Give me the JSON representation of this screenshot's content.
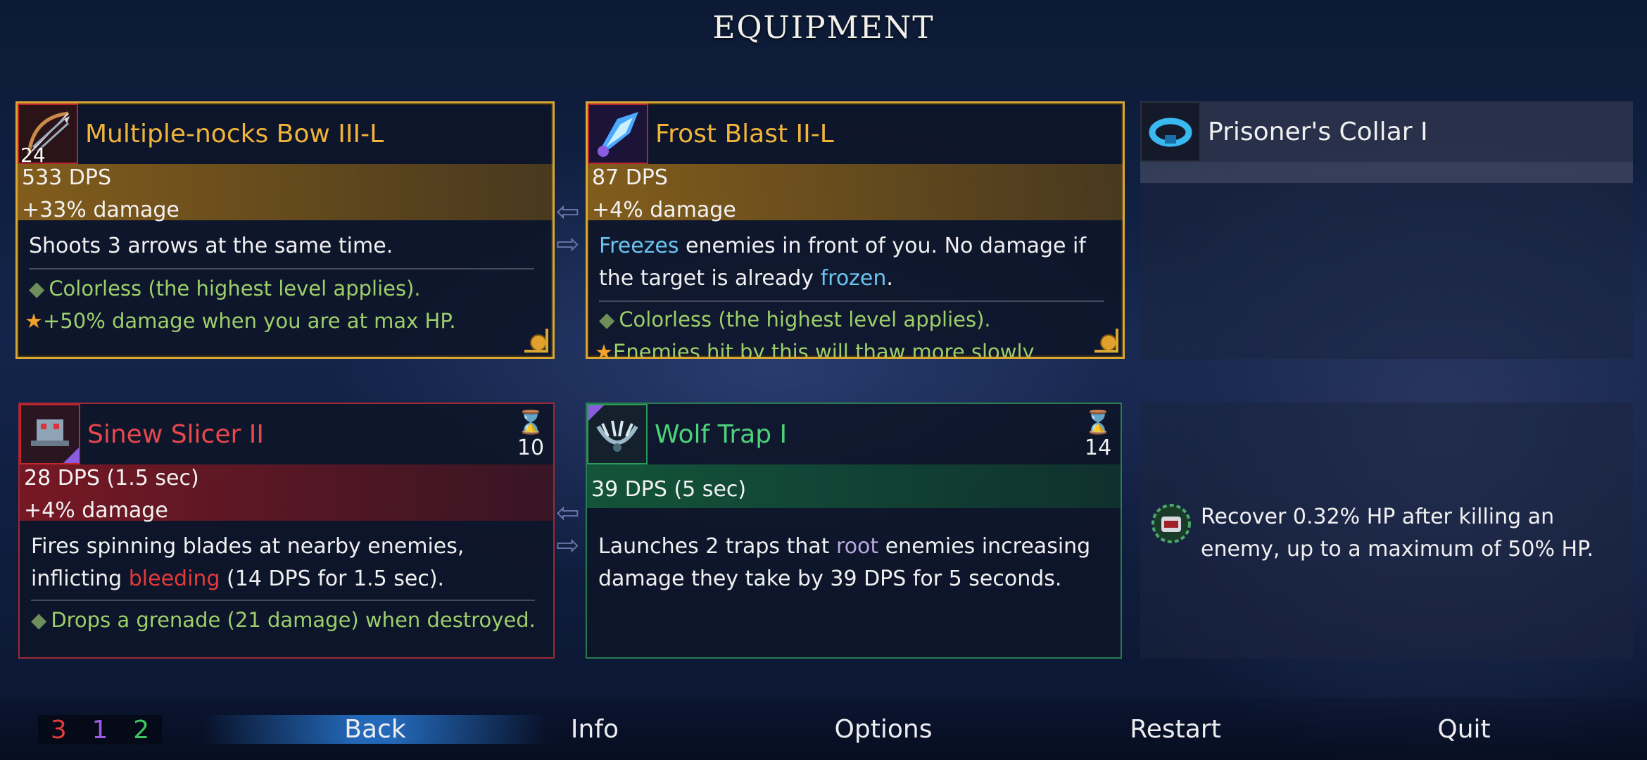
{
  "screen_title": "EQUIPMENT",
  "colors": {
    "gold": "#d9a832",
    "brutality": "#e23c3c",
    "tactics": "#9a5ce0",
    "survival": "#3cc860",
    "freeze": "#6cc4f0"
  },
  "cards": {
    "bow": {
      "name": "Multiple-nocks Bow III-L",
      "icon": "bow-icon",
      "ammo": "24",
      "dps": "533 DPS",
      "damage": "+33% damage",
      "description": "Shoots 3 arrows at the same time.",
      "bullets": [
        "Colorless (the highest level applies).",
        "+50% damage when you are at max HP."
      ]
    },
    "frost": {
      "name": "Frost Blast II-L",
      "icon": "frost-blast-icon",
      "dps": "87 DPS",
      "damage": "+4% damage",
      "desc_kw1": "Freezes",
      "desc_mid": " enemies in front of you. No damage if the target is already ",
      "desc_kw2": "frozen",
      "desc_end": ".",
      "bullets": [
        "Colorless (the highest level applies).",
        "Enemies hit by this will thaw more slowly"
      ]
    },
    "amulet": {
      "name": "Prisoner's Collar I",
      "icon": "collar-icon"
    },
    "slicer": {
      "name": "Sinew Slicer II",
      "icon": "sinew-slicer-icon",
      "cooldown": "10",
      "dps": "28 DPS (1.5 sec)",
      "damage": "+4% damage",
      "desc_start": "Fires spinning blades at nearby enemies, inflicting ",
      "desc_kw": "bleeding",
      "desc_end": " (14 DPS for 1.5 sec).",
      "bullets": [
        "Drops a grenade (21 damage) when destroyed."
      ]
    },
    "trap": {
      "name": "Wolf Trap I",
      "icon": "wolf-trap-icon",
      "cooldown": "14",
      "dps": "39 DPS (5 sec)",
      "desc_start": "Launches 2 traps that ",
      "desc_kw": "root",
      "desc_end": " enemies increasing damage they take by 39 DPS for 5 seconds."
    },
    "mutation": {
      "icon": "mutation-icon",
      "description": "Recover 0.32% HP after killing an enemy, up to a maximum of 50% HP."
    }
  },
  "scroll_counts": {
    "brutality": "3",
    "tactics": "1",
    "survival": "2"
  },
  "nav": {
    "back": "Back",
    "info": "Info",
    "options": "Options",
    "restart": "Restart",
    "quit": "Quit"
  }
}
